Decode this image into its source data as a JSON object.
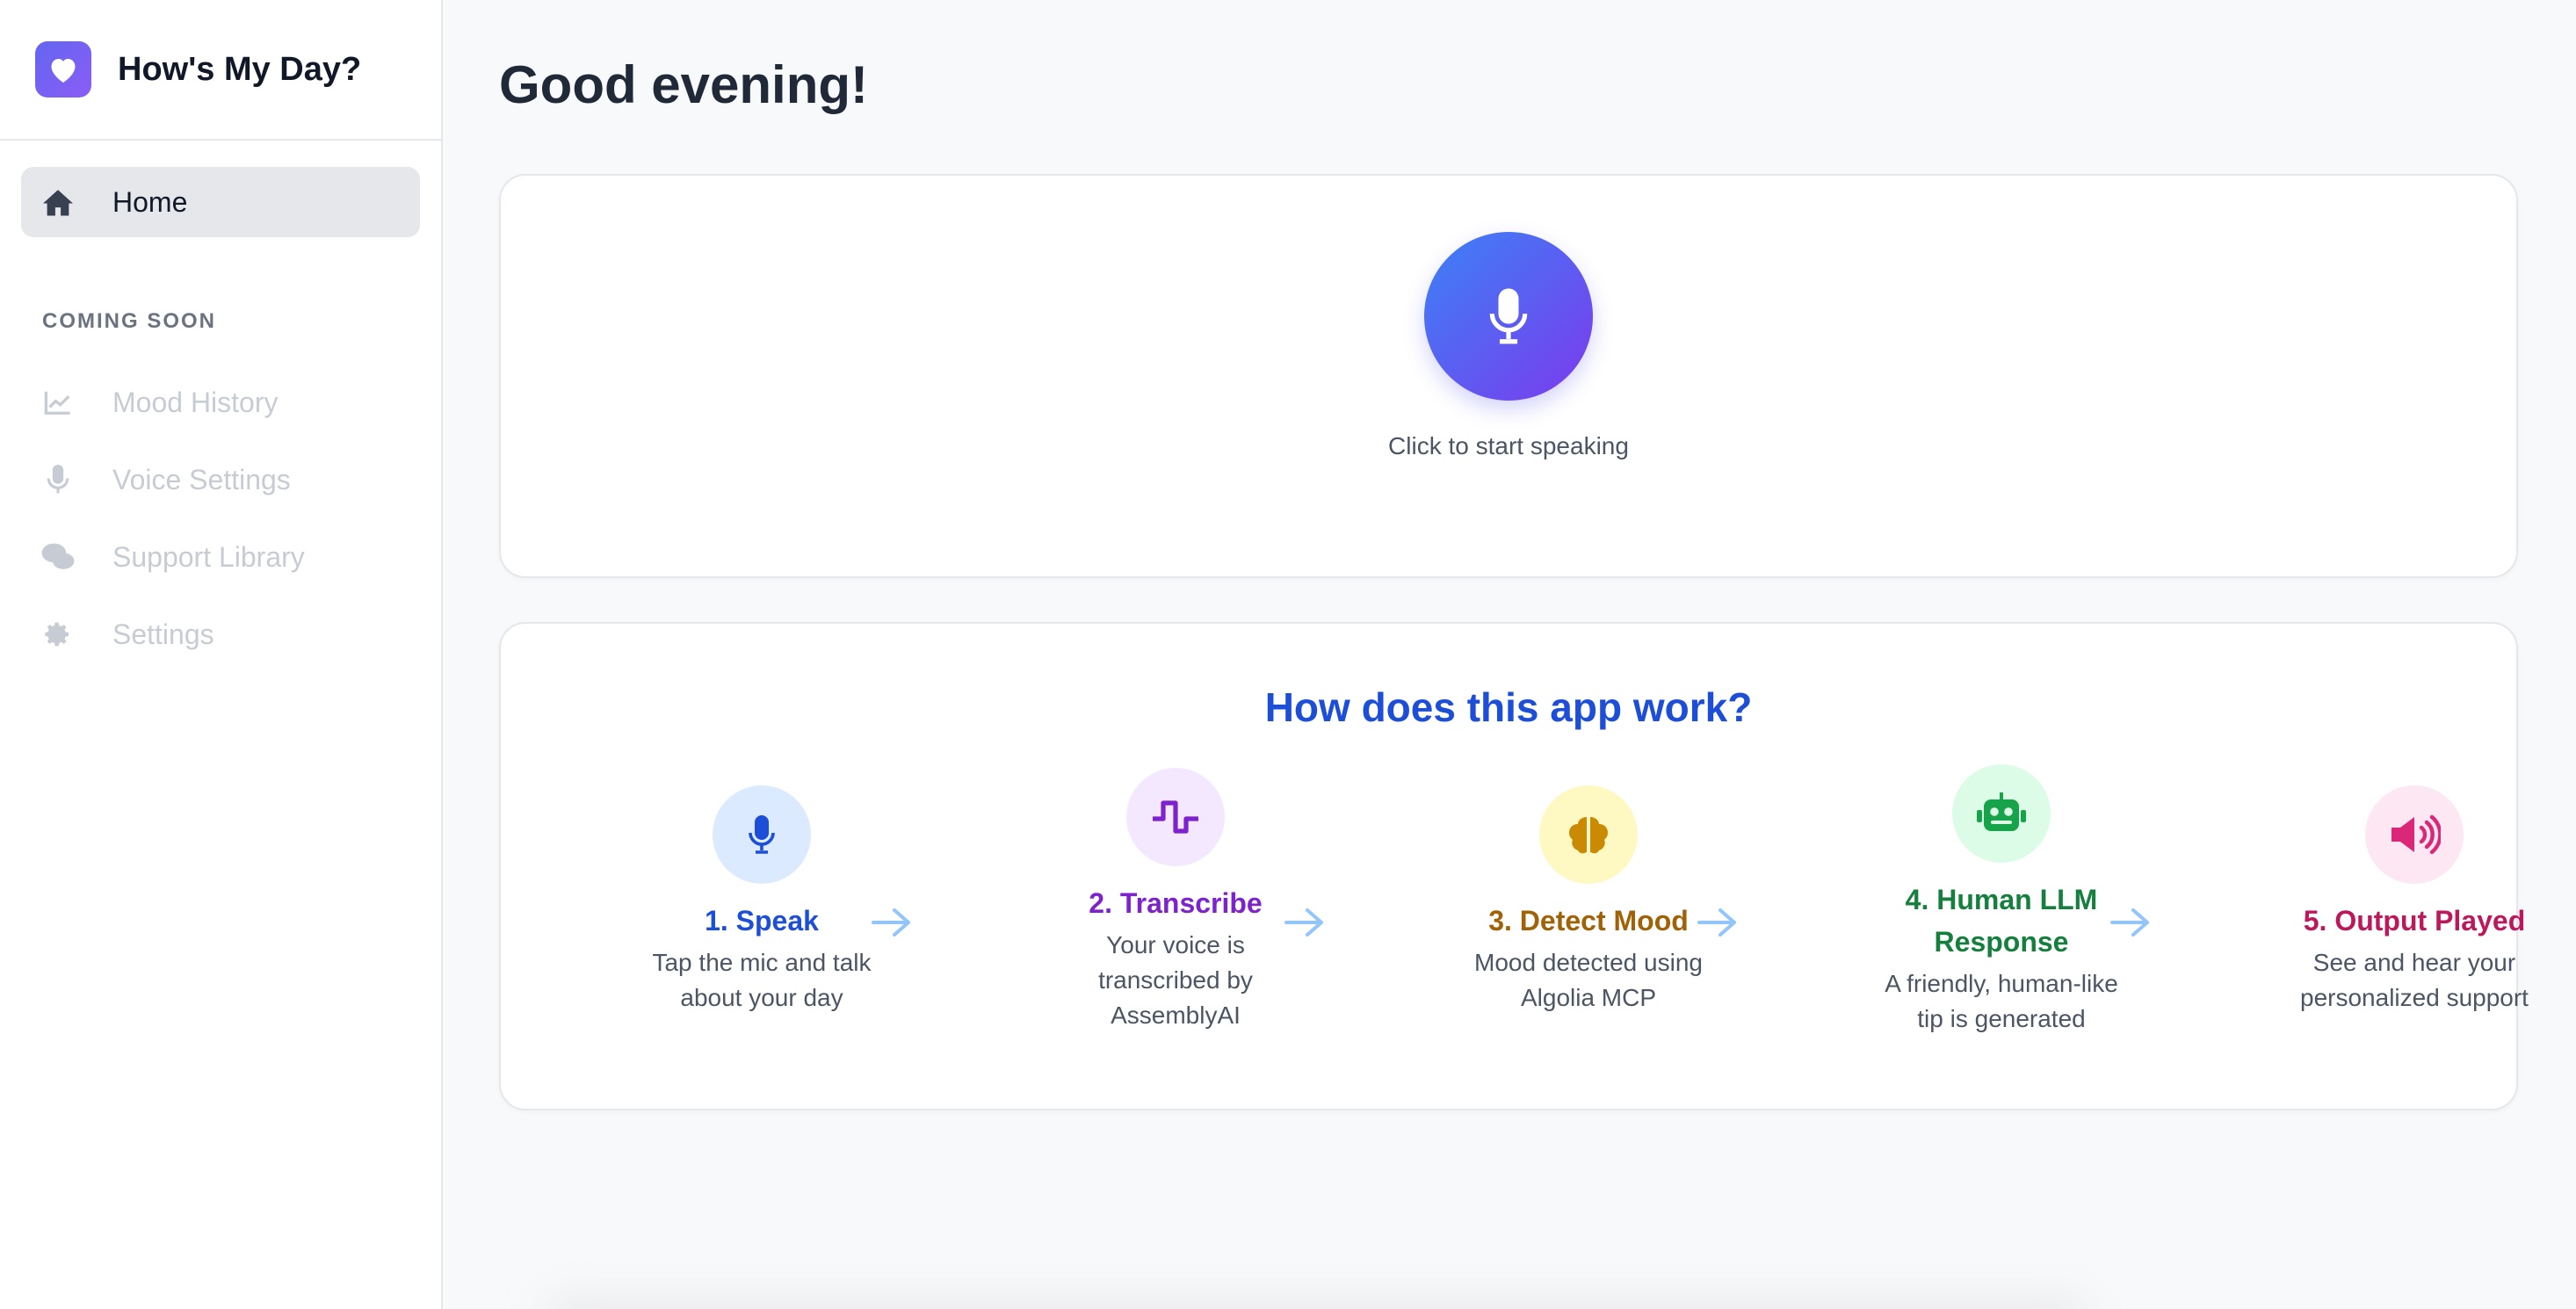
{
  "app": {
    "title": "How's My Day?"
  },
  "sidebar": {
    "home_label": "Home",
    "section_label": "COMING SOON",
    "items": [
      {
        "label": "Mood History",
        "icon": "chart-line-icon"
      },
      {
        "label": "Voice Settings",
        "icon": "microphone-icon"
      },
      {
        "label": "Support Library",
        "icon": "comments-icon"
      },
      {
        "label": "Settings",
        "icon": "gear-icon"
      }
    ]
  },
  "main": {
    "greeting": "Good evening!",
    "mic_hint": "Click to start speaking",
    "how_title": "How does this app work?",
    "steps": [
      {
        "title": "1. Speak",
        "desc": [
          "Tap the mic and talk",
          "about your day"
        ],
        "icon": "microphone-icon",
        "color": "#1d4ed8",
        "bg": "#dbeafe"
      },
      {
        "title": "2. Transcribe",
        "desc": [
          "Your voice is",
          "transcribed by",
          "AssemblyAI"
        ],
        "icon": "waveform-icon",
        "color": "#7e22ce",
        "bg": "#f3e8ff"
      },
      {
        "title": "3. Detect Mood",
        "desc": [
          "Mood detected using",
          "Algolia MCP"
        ],
        "icon": "brain-icon",
        "color": "#a16207",
        "bg": "#fef9c3"
      },
      {
        "title": [
          "4. Human LLM",
          "Response"
        ],
        "desc": [
          "A friendly, human-like",
          "tip is generated"
        ],
        "icon": "robot-icon",
        "color": "#15803d",
        "bg": "#dcfce7"
      },
      {
        "title": "5. Output Played",
        "desc": [
          "See and hear your",
          "personalized support"
        ],
        "icon": "speaker-icon",
        "color": "#be185d",
        "bg": "#fce7f3"
      }
    ]
  },
  "colors": {
    "accent_start": "#3b82f6",
    "accent_end": "#7c3aed",
    "arrow": "#93c5fd"
  }
}
